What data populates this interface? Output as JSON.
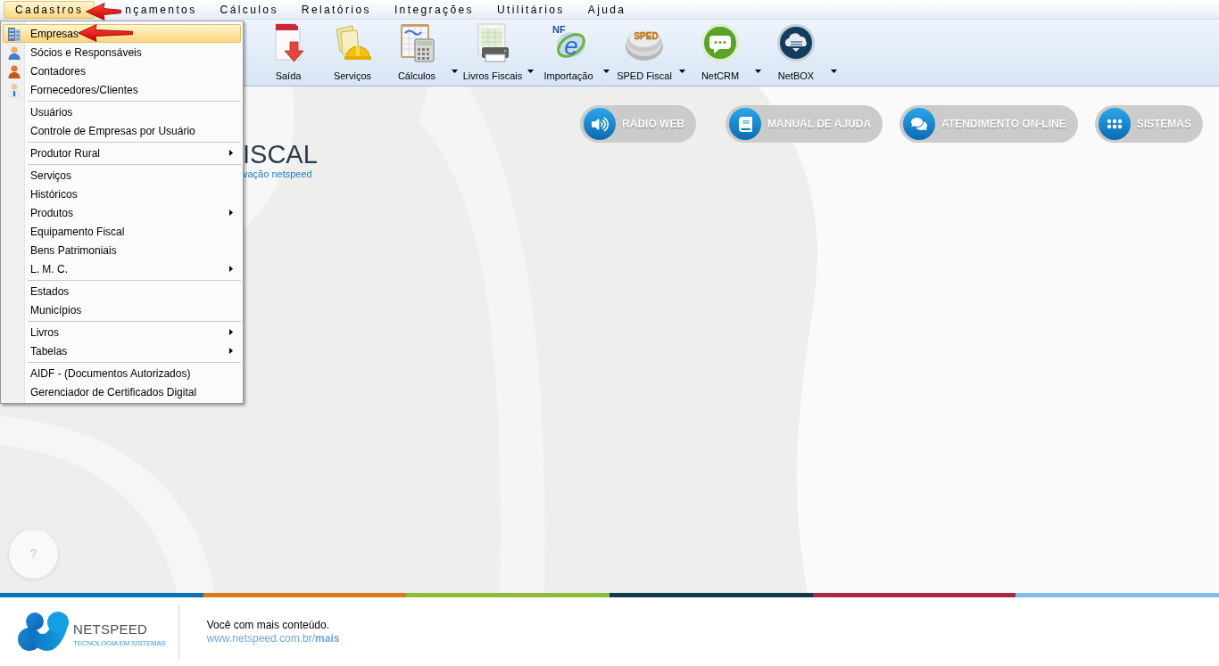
{
  "menu_bar": [
    {
      "label": "Cadastros",
      "selected": true
    },
    {
      "label": "nçamentos",
      "selected": false
    },
    {
      "label": "Cálculos",
      "selected": false
    },
    {
      "label": "Relatórios",
      "selected": false
    },
    {
      "label": "Integrações",
      "selected": false
    },
    {
      "label": "Utilitários",
      "selected": false
    },
    {
      "label": "Ajuda",
      "selected": false
    }
  ],
  "toolbar": [
    {
      "kind": "exit",
      "label": "Saída",
      "has_dropdown": false
    },
    {
      "kind": "services",
      "label": "Serviços",
      "has_dropdown": false
    },
    {
      "kind": "calculations",
      "label": "Cálculos",
      "has_dropdown": true
    },
    {
      "kind": "books",
      "label": "Livros Fiscais",
      "has_dropdown": true
    },
    {
      "kind": "import",
      "label": "Importação",
      "has_dropdown": true,
      "icon_texts": [
        "NF",
        "e"
      ]
    },
    {
      "kind": "sped",
      "label": "SPED Fiscal",
      "has_dropdown": true,
      "icon_texts": [
        "SPED"
      ]
    },
    {
      "kind": "crm",
      "label": "NetCRM",
      "has_dropdown": true
    },
    {
      "kind": "box",
      "label": "NetBOX",
      "has_dropdown": true
    }
  ],
  "dropdown_menu": {
    "sections": [
      {
        "items": [
          {
            "kind": "company",
            "label": "Empresas",
            "selected": true,
            "has_submenu": false
          },
          {
            "kind": "partner",
            "label": "Sócios e Responsáveis",
            "selected": false,
            "has_submenu": false
          },
          {
            "kind": "accountant",
            "label": "Contadores",
            "selected": false,
            "has_submenu": false
          },
          {
            "kind": "supplier",
            "label": "Fornecedores/Clientes",
            "selected": false,
            "has_submenu": false
          }
        ]
      },
      {
        "items": [
          {
            "kind": "plain",
            "label": "Usuários",
            "selected": false,
            "has_submenu": false
          },
          {
            "kind": "plain",
            "label": "Controle de Empresas por Usuário",
            "selected": false,
            "has_submenu": false
          }
        ]
      },
      {
        "items": [
          {
            "kind": "plain",
            "label": "Produtor Rural",
            "selected": false,
            "has_submenu": true
          }
        ]
      },
      {
        "items": [
          {
            "kind": "plain",
            "label": "Serviços",
            "selected": false,
            "has_submenu": false
          },
          {
            "kind": "plain",
            "label": "Históricos",
            "selected": false,
            "has_submenu": false
          },
          {
            "kind": "plain",
            "label": "Produtos",
            "selected": false,
            "has_submenu": true
          },
          {
            "kind": "plain",
            "label": "Equipamento Fiscal",
            "selected": false,
            "has_submenu": false
          },
          {
            "kind": "plain",
            "label": "Bens Patrimoniais",
            "selected": false,
            "has_submenu": false
          },
          {
            "kind": "plain",
            "label": "L. M. C.",
            "selected": false,
            "has_submenu": true
          }
        ]
      },
      {
        "items": [
          {
            "kind": "plain",
            "label": "Estados",
            "selected": false,
            "has_submenu": false
          },
          {
            "kind": "plain",
            "label": "Municípios",
            "selected": false,
            "has_submenu": false
          }
        ]
      },
      {
        "items": [
          {
            "kind": "plain",
            "label": "Livros",
            "selected": false,
            "has_submenu": true
          },
          {
            "kind": "plain",
            "label": "Tabelas",
            "selected": false,
            "has_submenu": true
          }
        ]
      },
      {
        "items": [
          {
            "kind": "plain",
            "label": "AIDF - (Documentos Autorizados)",
            "selected": false,
            "has_submenu": false
          },
          {
            "kind": "plain",
            "label": "Gerenciador de Certificados Digital",
            "selected": false,
            "has_submenu": false
          }
        ]
      }
    ]
  },
  "quick_links": [
    {
      "kind": "radio",
      "label": "RÁDIO WEB"
    },
    {
      "kind": "manual",
      "label": "MANUAL DE AJUDA"
    },
    {
      "kind": "chat",
      "label": "ATENDIMENTO ON-LINE"
    },
    {
      "kind": "systems",
      "label": "SISTEMAS"
    }
  ],
  "product_logo": {
    "name": "ISCAL",
    "tagline": "vação netspeed"
  },
  "help_button": {
    "label": "?"
  },
  "color_stripe": [
    {
      "color": "#0b72b5"
    },
    {
      "color": "#d87a1c"
    },
    {
      "color": "#8dbb3e"
    },
    {
      "color": "#0f3a4a"
    },
    {
      "color": "#a8294a"
    },
    {
      "color": "#7fbde9"
    }
  ],
  "footer": {
    "brand_name": "NETSPEED",
    "brand_tagline": "TECNOLOGIA EM SISTEMAS",
    "message": "Você com mais conteúdo.",
    "link": "www.netspeed.com.br/**mais**"
  }
}
